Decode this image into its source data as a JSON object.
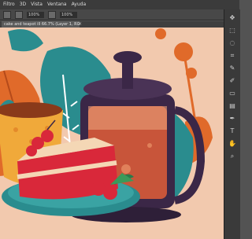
{
  "menubar": {
    "items": [
      "Filtro",
      "3D",
      "Vista",
      "Ventana",
      "Ayuda"
    ]
  },
  "options_bar": {
    "zoom_value": "100%",
    "fill_value": "100%"
  },
  "document_tab": {
    "title": "cake and teapot ill 66.7% (Layer 1, RGB/8)",
    "close": "×"
  },
  "tools": [
    {
      "icon": "move-icon"
    },
    {
      "icon": "marquee-icon"
    },
    {
      "icon": "lasso-icon"
    },
    {
      "icon": "crop-icon"
    },
    {
      "icon": "eyedropper-icon"
    },
    {
      "icon": "brush-icon"
    },
    {
      "icon": "eraser-icon"
    },
    {
      "icon": "gradient-icon"
    },
    {
      "icon": "pen-icon"
    },
    {
      "icon": "type-icon"
    },
    {
      "icon": "hand-icon"
    },
    {
      "icon": "zoom-icon"
    }
  ],
  "colors": {
    "background": "#f2c9ae",
    "teal": "#2a8c8e",
    "orange": "#e06a2a",
    "dark_purple": "#3b2747",
    "cake_red": "#d9283a"
  }
}
